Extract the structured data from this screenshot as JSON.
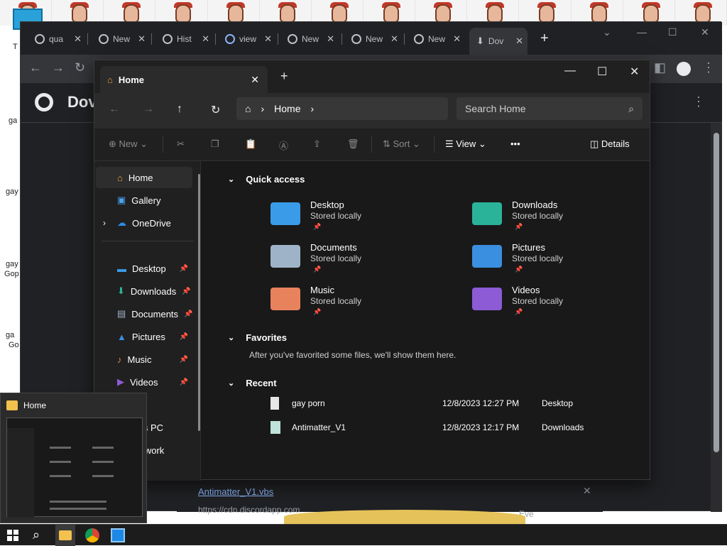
{
  "chrome": {
    "tabs": [
      {
        "label": "qua",
        "icon": "google-icon"
      },
      {
        "label": "New",
        "icon": "chrome-icon"
      },
      {
        "label": "Hist",
        "icon": "history-icon"
      },
      {
        "label": "view",
        "icon": "loading-icon"
      },
      {
        "label": "New",
        "icon": "chrome-icon"
      },
      {
        "label": "New",
        "icon": "chrome-icon"
      },
      {
        "label": "New",
        "icon": "chrome-icon"
      },
      {
        "label": "Dov",
        "icon": "download-icon"
      }
    ],
    "page_title": "Dov",
    "download_item": {
      "filename": "Antimatter_V1.vbs",
      "url": "https://cdn.discordapp.com"
    },
    "partial_text": "Eve"
  },
  "desktop": {
    "side_labels": [
      "T",
      "ga",
      "gay",
      "gay",
      "gay",
      "Gop",
      "ga",
      "Go"
    ]
  },
  "explorer": {
    "tab_title": "Home",
    "breadcrumb": "Home",
    "search_placeholder": "Search Home",
    "commands": {
      "new": "New",
      "sort": "Sort",
      "view": "View",
      "more": "•••",
      "details": "Details"
    },
    "sidebar": [
      {
        "label": "Home",
        "icon": "home-icon",
        "pinned": false
      },
      {
        "label": "Gallery",
        "icon": "gallery-icon",
        "pinned": false
      },
      {
        "label": "OneDrive",
        "icon": "onedrive-icon",
        "pinned": false
      },
      {
        "label": "Desktop",
        "icon": "desktop-icon",
        "pinned": true
      },
      {
        "label": "Downloads",
        "icon": "downloads-icon",
        "pinned": true
      },
      {
        "label": "Documents",
        "icon": "documents-icon",
        "pinned": true
      },
      {
        "label": "Pictures",
        "icon": "pictures-icon",
        "pinned": true
      },
      {
        "label": "Music",
        "icon": "music-icon",
        "pinned": true
      },
      {
        "label": "Videos",
        "icon": "videos-icon",
        "pinned": true
      },
      {
        "label": "is PC",
        "icon": "pc-icon",
        "pinned": false
      },
      {
        "label": "etwork",
        "icon": "network-icon",
        "pinned": false
      }
    ],
    "sections": {
      "quick_access": "Quick access",
      "favorites": "Favorites",
      "favorites_empty": "After you've favorited some files, we'll show them here.",
      "recent": "Recent"
    },
    "quick_access": [
      {
        "name": "Desktop",
        "status": "Stored locally",
        "color": "#3a9be8"
      },
      {
        "name": "Downloads",
        "status": "Stored locally",
        "color": "#2bb39a"
      },
      {
        "name": "Documents",
        "status": "Stored locally",
        "color": "#9fb3c8"
      },
      {
        "name": "Pictures",
        "status": "Stored locally",
        "color": "#3b8fe0"
      },
      {
        "name": "Music",
        "status": "Stored locally",
        "color": "#e8825d"
      },
      {
        "name": "Videos",
        "status": "Stored locally",
        "color": "#8e5bd6"
      }
    ],
    "recent": [
      {
        "name": "gay porn",
        "date": "12/8/2023 12:27 PM",
        "location": "Desktop"
      },
      {
        "name": "Antimatter_V1",
        "date": "12/8/2023 12:17 PM",
        "location": "Downloads"
      }
    ]
  },
  "taskbar": {
    "preview_title": "Home",
    "icons": [
      "start-icon",
      "search-icon",
      "file-explorer-icon",
      "chrome-icon",
      "app-icon"
    ]
  }
}
